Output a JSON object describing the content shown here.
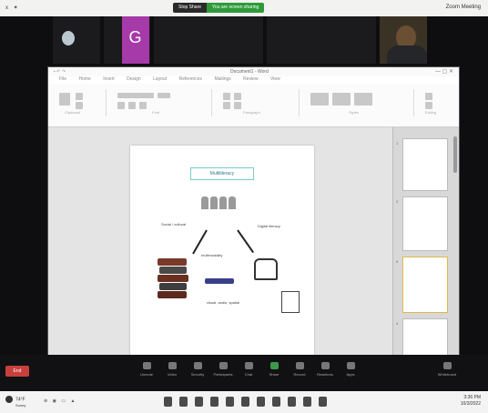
{
  "top_bar": {
    "left_indicator": "x ✦",
    "share_label_1": "Stop Share",
    "share_label_2": "You are screen sharing",
    "right_label": "Zoom Meeting"
  },
  "participants": [
    {
      "name": "",
      "type": "avatar"
    },
    {
      "name": "",
      "type": "initial",
      "initial": "G"
    },
    {
      "name": "",
      "type": "wide"
    },
    {
      "name": "",
      "type": "camera"
    }
  ],
  "word": {
    "title": "Document1 - Word",
    "menu_items": [
      "File",
      "Home",
      "Insert",
      "Design",
      "Layout",
      "References",
      "Mailings",
      "Review",
      "View"
    ],
    "ribbon_groups": [
      "Clipboard",
      "Font",
      "Paragraph",
      "Styles",
      "Editing"
    ],
    "page": {
      "heading": "Multiliteracy",
      "left_label": "Social / cultural",
      "right_label": "Digital literacy",
      "center_label": "multimodality",
      "bottom_label": "visual, audio, spatial",
      "footer": ""
    },
    "nav_slides": [
      "1",
      "2",
      "3",
      "4"
    ]
  },
  "toolbar": {
    "end_label": "End",
    "items": [
      "Unmute",
      "Video",
      "Security",
      "Participants",
      "Chat",
      "Share",
      "Record",
      "Reactions",
      "Apps",
      "Whiteboard"
    ]
  },
  "taskbar": {
    "weather_temp": "74°F",
    "weather_desc": "Sunny",
    "time": "3:36 PM",
    "date": "10/3/2022"
  },
  "colors": {
    "meeting_bg": "#0e0e10",
    "share_green": "#2f9a3a",
    "avatar_purple": "#a63aa8",
    "end_red": "#c8403d"
  }
}
